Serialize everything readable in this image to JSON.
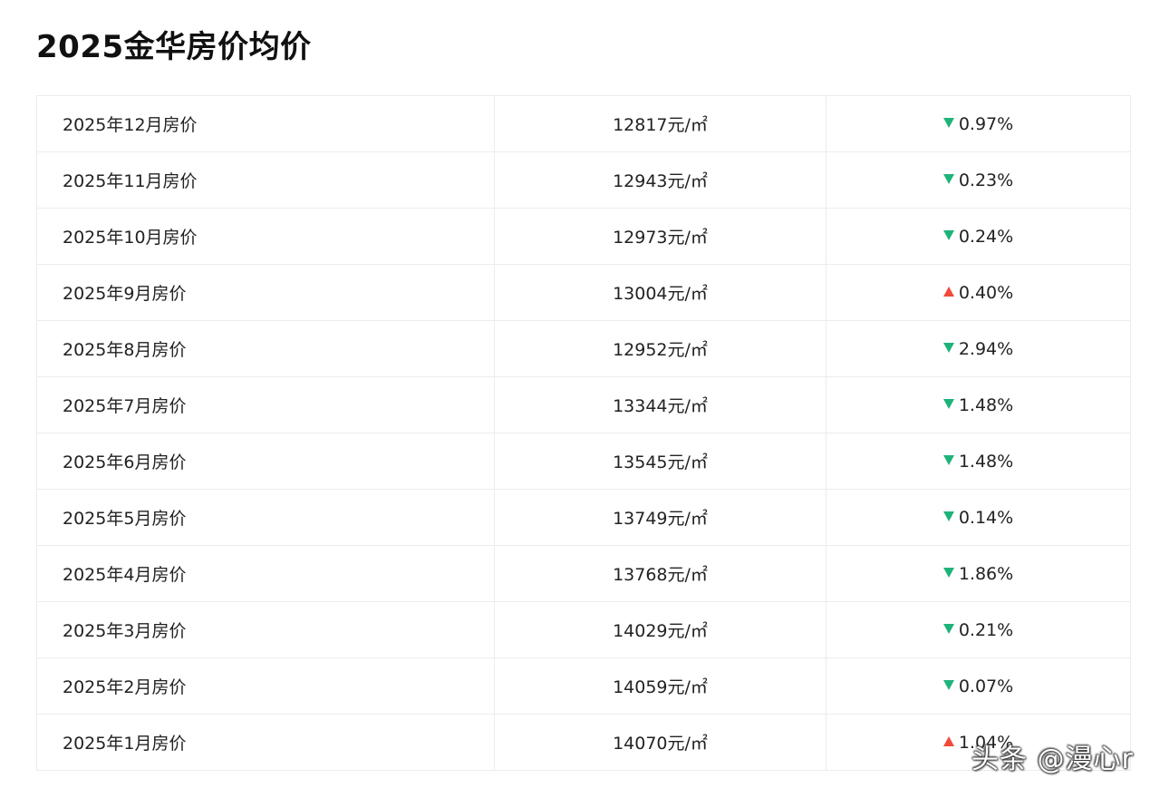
{
  "title": "2025金华房价均价",
  "rows": [
    {
      "month": "2025年12月房价",
      "price": "12817元/㎡",
      "direction": "down",
      "change": "0.97%"
    },
    {
      "month": "2025年11月房价",
      "price": "12943元/㎡",
      "direction": "down",
      "change": "0.23%"
    },
    {
      "month": "2025年10月房价",
      "price": "12973元/㎡",
      "direction": "down",
      "change": "0.24%"
    },
    {
      "month": "2025年9月房价",
      "price": "13004元/㎡",
      "direction": "up",
      "change": "0.40%"
    },
    {
      "month": "2025年8月房价",
      "price": "12952元/㎡",
      "direction": "down",
      "change": "2.94%"
    },
    {
      "month": "2025年7月房价",
      "price": "13344元/㎡",
      "direction": "down",
      "change": "1.48%"
    },
    {
      "month": "2025年6月房价",
      "price": "13545元/㎡",
      "direction": "down",
      "change": "1.48%"
    },
    {
      "month": "2025年5月房价",
      "price": "13749元/㎡",
      "direction": "down",
      "change": "0.14%"
    },
    {
      "month": "2025年4月房价",
      "price": "13768元/㎡",
      "direction": "down",
      "change": "1.86%"
    },
    {
      "month": "2025年3月房价",
      "price": "14029元/㎡",
      "direction": "down",
      "change": "0.21%"
    },
    {
      "month": "2025年2月房价",
      "price": "14059元/㎡",
      "direction": "down",
      "change": "0.07%"
    },
    {
      "month": "2025年1月房价",
      "price": "14070元/㎡",
      "direction": "up",
      "change": "1.04%"
    }
  ],
  "icons": {
    "down": "down-triangle-icon",
    "up": "up-triangle-icon"
  },
  "colors": {
    "down": "#1fb37a",
    "up": "#f04a3a"
  },
  "watermark": "头条 @漫心r"
}
